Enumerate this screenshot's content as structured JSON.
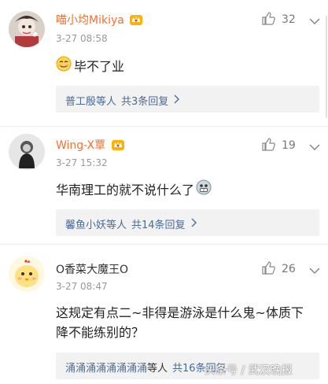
{
  "comments": [
    {
      "username": "喵小均Mikiya",
      "time": "3-27 08:58",
      "likes": "32",
      "content": "毕不了业",
      "reply_names": "普工殷等人",
      "reply_count": "共3条回复",
      "avatar_icon": "cartoon-avatar",
      "badge_icon": "vip-crown-icon",
      "content_emoji": "awkward-smile-emoji"
    },
    {
      "username": "Wing-X覃",
      "time": "3-27 15:32",
      "likes": "19",
      "content": "华南理工的就不说什么了",
      "reply_names": "馨鱼小妖等人",
      "reply_count": "共14条回复",
      "avatar_icon": "person-photo-avatar",
      "badge_icon": "vip-crown-icon",
      "content_emoji": "grimace-emoji"
    },
    {
      "username": "O香菜大魔王O",
      "time": "3-27 08:47",
      "likes": "26",
      "content_line1": "这规定有点二~非得是游泳是什么鬼~体质下",
      "content_line2": "降不能练别的？",
      "reply_names": "涌涌涌涌涌涌涌涌",
      "reply_names_suffix": "等人",
      "reply_count": "共16条回复",
      "avatar_icon": "chick-avatar"
    }
  ],
  "watermark": "头条号 / 武汉晚报",
  "colors": {
    "username_orange": "#f86e2c",
    "username_dark": "#333333",
    "link_blue": "#4a6c95",
    "reply_bg": "#f2f2f2"
  }
}
